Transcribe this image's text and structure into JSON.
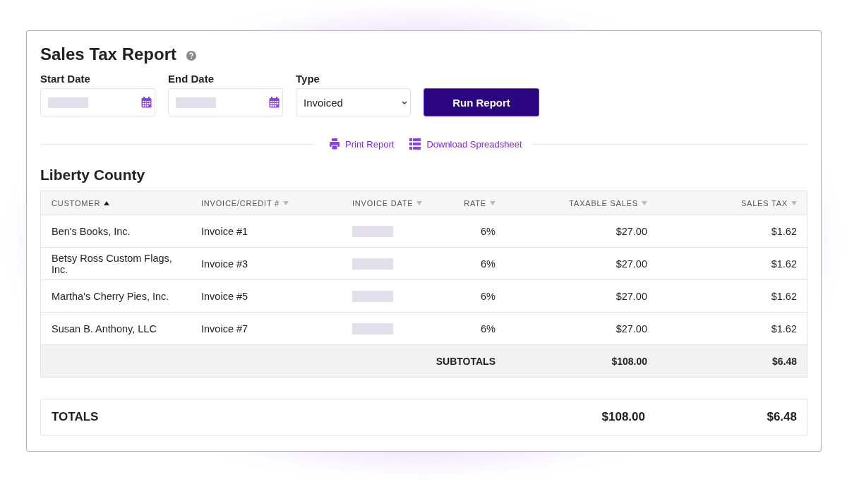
{
  "title": "Sales Tax Report",
  "filters": [
    {
      "kind": "date",
      "label": "Start Date"
    },
    {
      "kind": "date",
      "label": "End Date"
    },
    {
      "kind": "select",
      "label": "Type",
      "value": "Invoiced"
    }
  ],
  "run_button": "Run Report",
  "actions": [
    {
      "kind": "print",
      "label": "Print Report"
    },
    {
      "kind": "spreadsheet",
      "label": "Download Spreadsheet"
    }
  ],
  "section": "Liberty County",
  "columns": [
    {
      "label": "CUSTOMER",
      "sorted": true
    },
    {
      "label": "INVOICE/CREDIT #",
      "sorted": false
    },
    {
      "label": "INVOICE DATE",
      "sorted": false
    },
    {
      "label": "RATE",
      "sorted": false
    },
    {
      "label": "TAXABLE SALES",
      "sorted": false
    },
    {
      "label": "SALES TAX",
      "sorted": false
    }
  ],
  "rows": [
    {
      "customer": "Ben's Books, Inc.",
      "invoice": "Invoice #1",
      "rate": "6%",
      "taxable": "$27.00",
      "tax": "$1.62"
    },
    {
      "customer": "Betsy Ross Custom Flags, Inc.",
      "invoice": "Invoice #3",
      "rate": "6%",
      "taxable": "$27.00",
      "tax": "$1.62"
    },
    {
      "customer": "Martha's Cherry Pies, Inc.",
      "invoice": "Invoice #5",
      "rate": "6%",
      "taxable": "$27.00",
      "tax": "$1.62"
    },
    {
      "customer": "Susan B. Anthony, LLC",
      "invoice": "Invoice #7",
      "rate": "6%",
      "taxable": "$27.00",
      "tax": "$1.62"
    }
  ],
  "subtotals": {
    "label": "SUBTOTALS",
    "taxable": "$108.00",
    "tax": "$6.48"
  },
  "totals": {
    "label": "TOTALS",
    "taxable": "$108.00",
    "tax": "$6.48"
  }
}
